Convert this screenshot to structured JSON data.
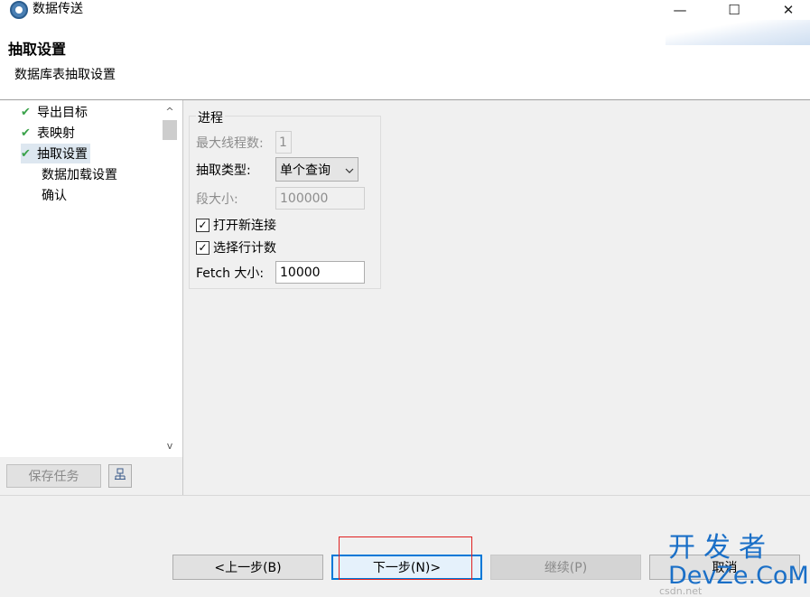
{
  "window": {
    "title": "数据传送",
    "minimize_glyph": "—",
    "maximize_glyph": "☐",
    "close_glyph": "✕"
  },
  "header": {
    "title": "抽取设置",
    "subtitle": "数据库表抽取设置"
  },
  "nav": {
    "items": [
      {
        "label": "导出目标",
        "checked": true
      },
      {
        "label": "表映射",
        "checked": true
      },
      {
        "label": "抽取设置",
        "checked": true,
        "selected": true
      },
      {
        "label": "数据加载设置",
        "checked": false
      },
      {
        "label": "确认",
        "checked": false
      }
    ],
    "save_task_label": "保存任务",
    "check_glyph": "✔",
    "scroll_up_glyph": "^",
    "scroll_down_glyph": "v"
  },
  "process_group": {
    "legend": "进程",
    "max_threads_label": "最大线程数:",
    "max_threads_value": "1",
    "extract_type_label": "抽取类型:",
    "extract_type_value": "单个查询",
    "segment_size_label": "段大小:",
    "segment_size_value": "100000",
    "open_new_connection_label": "打开新连接",
    "open_new_connection_checked": true,
    "select_row_count_label": "选择行计数",
    "select_row_count_checked": true,
    "fetch_size_label": "Fetch 大小:",
    "fetch_size_value": "10000"
  },
  "buttons": {
    "prev": "<上一步(B)",
    "next": "下一步(N)>",
    "continue": "继续(P)",
    "cancel": "取消"
  },
  "watermark": {
    "line1": "开发者",
    "line2": "DevZe.CoM",
    "small": "csdn.net"
  },
  "colors": {
    "accent": "#0078d7",
    "check_green": "#3aa24a",
    "highlight_red": "#e02020",
    "watermark_blue": "#1a6fc7"
  }
}
